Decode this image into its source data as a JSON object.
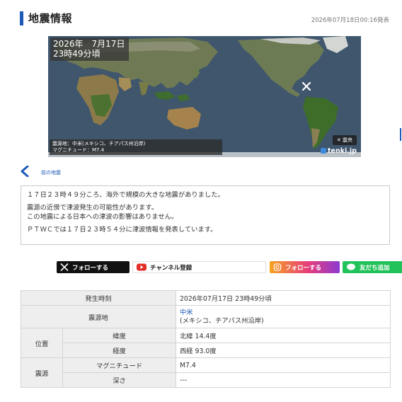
{
  "header": {
    "title": "地震情報",
    "issued": "2026年07月18日00:16発表",
    "accent": "#1e5bb8"
  },
  "map": {
    "date_line1": "2026年　7月17日",
    "date_line2": "23時49分頃",
    "info_line1": "震源地：中米(メキシコ、チアパス州沿岸)",
    "info_line2": "マグニチュード：M7.4",
    "legend_marker": "✕",
    "legend_label": "震央",
    "brand": "tenki.jp"
  },
  "prev_link": {
    "label": "前の地震"
  },
  "message": {
    "line1": "１７日２３時４９分ころ、海外で規模の大きな地震がありました。",
    "line2": "震源の近傍で津波発生の可能性があります。",
    "line3": "この地震による日本への津波の影響はありません。",
    "line4": "ＰＴＷＣでは１７日２３時５４分に津波情報を発表しています。"
  },
  "follow": {
    "x_label": "フォローする",
    "youtube_label": "チャンネル登録",
    "instagram_label": "フォローする",
    "line_label": "友だち追加"
  },
  "table": {
    "time_label": "発生時刻",
    "time_value": "2026年07月17日 23時49分頃",
    "epicenter_label": "震源地",
    "epicenter_link": "中米",
    "epicenter_detail": "(メキシコ、チアパス州沿岸)",
    "position_label": "位置",
    "lat_label": "緯度",
    "lat_value": "北緯 14.4度",
    "lon_label": "経度",
    "lon_value": "西経 93.0度",
    "source_label": "震源",
    "mag_label": "マグニチュード",
    "mag_value": "M7.4",
    "depth_label": "深さ",
    "depth_value": "---"
  }
}
